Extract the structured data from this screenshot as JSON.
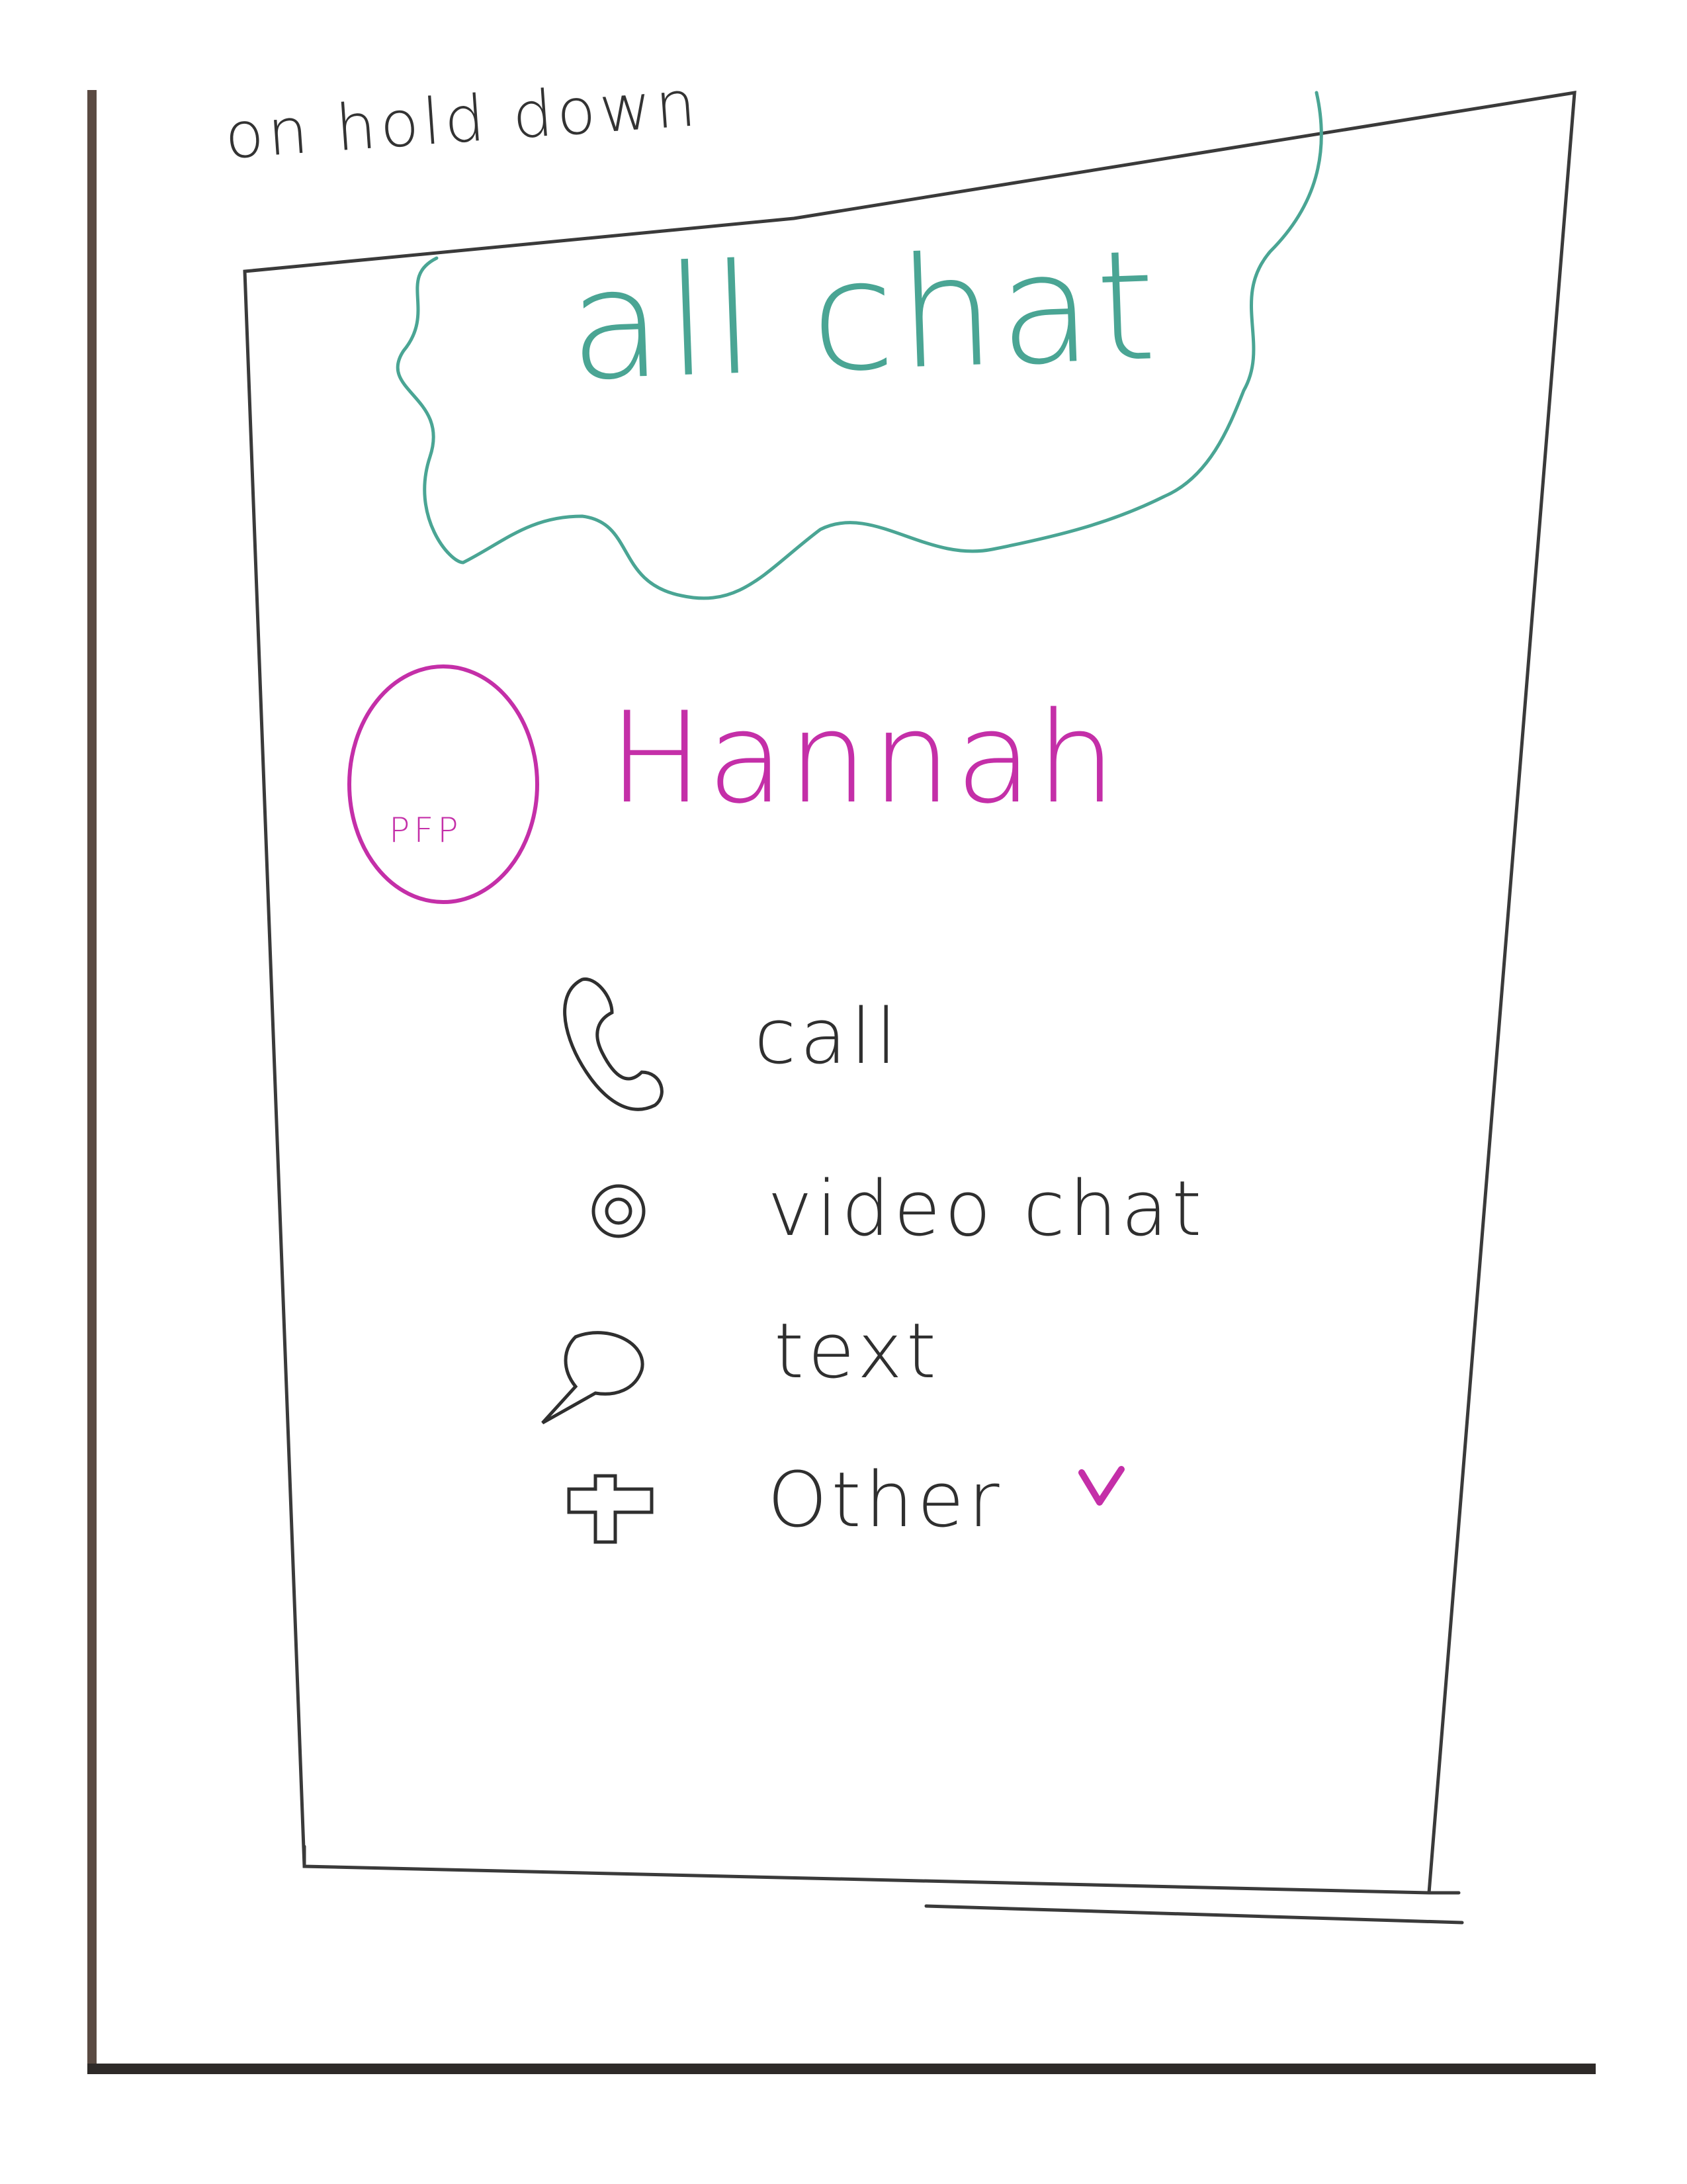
{
  "top_note": "on hold down",
  "header": {
    "title": "all chat",
    "accent_color": "#4aa594"
  },
  "contact": {
    "name": "Hannah",
    "avatar_label": "PFP",
    "accent_color": "#c42fa8"
  },
  "actions": [
    {
      "label": "call",
      "icon": "phone-icon"
    },
    {
      "label": "video chat",
      "icon": "video-camera-icon"
    },
    {
      "label": "text",
      "icon": "speech-bubble-icon"
    },
    {
      "label": "Other",
      "icon": "plus-icon",
      "extra_icon": "chevron-down-icon"
    }
  ],
  "colors": {
    "ink": "#2f2f2f",
    "frame": "#3a3a3a"
  }
}
